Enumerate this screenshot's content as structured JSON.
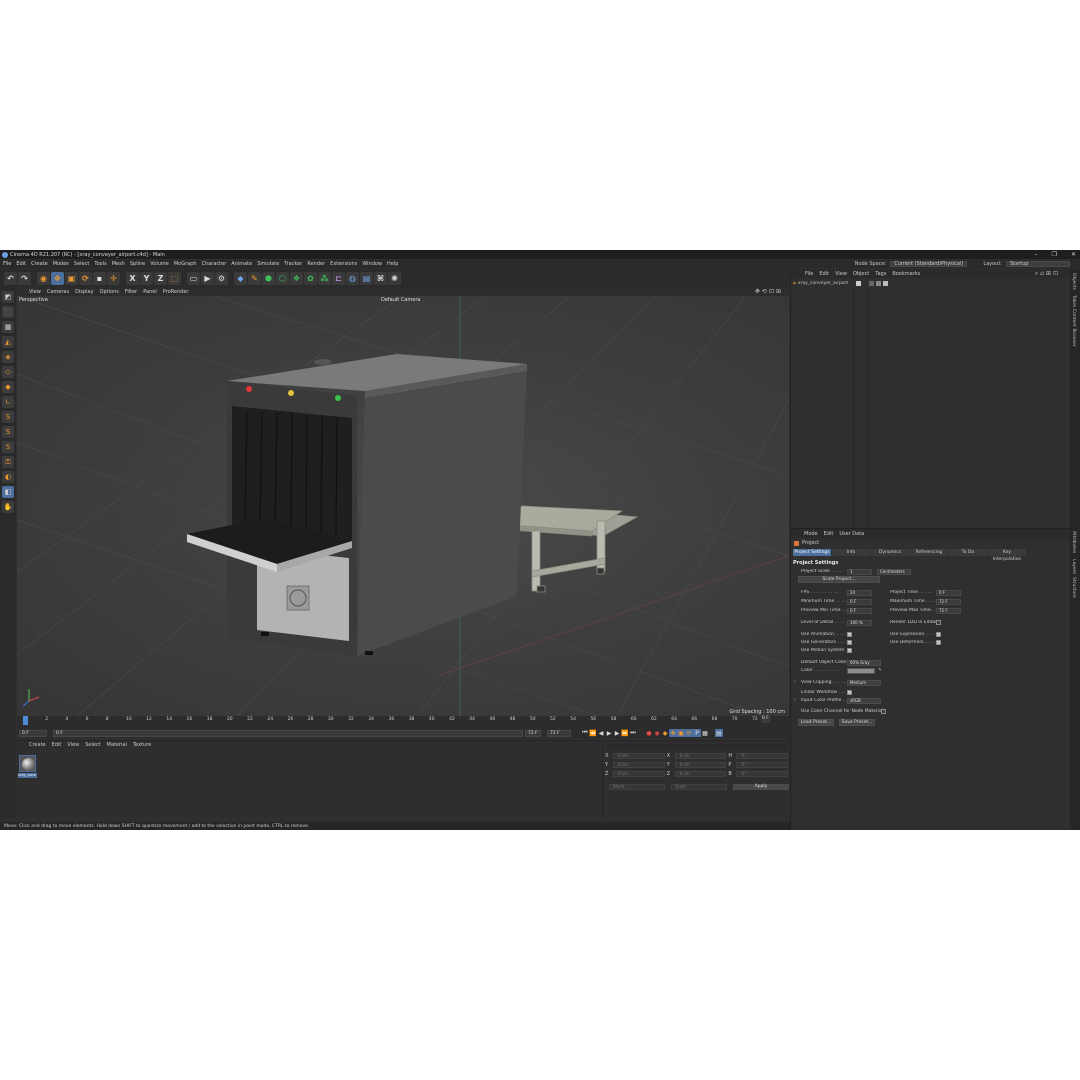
{
  "window": {
    "title": "Cinema 4D R21.207 (RC) - [xray_conveyer_airport.c4d] - Main",
    "controls": [
      "–",
      "❐",
      "✕"
    ]
  },
  "menubar": {
    "items": [
      "File",
      "Edit",
      "Create",
      "Modes",
      "Select",
      "Tools",
      "Mesh",
      "Spline",
      "Volume",
      "MoGraph",
      "Character",
      "Animate",
      "Simulate",
      "Tracker",
      "Render",
      "Extensions",
      "Window",
      "Help"
    ],
    "node_space_label": "Node Space:",
    "node_space_value": "Current (Standard/Physical)",
    "layout_label": "Layout:",
    "layout_value": "Startup"
  },
  "toolbar": {
    "axis_x": "X",
    "axis_y": "Y",
    "axis_z": "Z"
  },
  "viewport": {
    "menu": [
      "View",
      "Cameras",
      "Display",
      "Options",
      "Filter",
      "Panel",
      "ProRender"
    ],
    "view_name": "Perspective",
    "camera": "Default Camera",
    "grid_spacing": "Grid Spacing : 100 cm"
  },
  "timeline": {
    "ticks": [
      "0",
      "2",
      "4",
      "6",
      "8",
      "10",
      "12",
      "14",
      "16",
      "18",
      "20",
      "22",
      "24",
      "26",
      "28",
      "30",
      "32",
      "34",
      "36",
      "38",
      "40",
      "42",
      "44",
      "46",
      "48",
      "50",
      "52",
      "54",
      "56",
      "58",
      "60",
      "62",
      "64",
      "66",
      "68",
      "70",
      "72"
    ],
    "end_frame_display": "0 F",
    "current_frame": "0 F",
    "start_field": "0 F",
    "end_field": "72 F",
    "end_field2": "72 F"
  },
  "material_manager": {
    "menu": [
      "Create",
      "Edit",
      "View",
      "Select",
      "Material",
      "Texture"
    ],
    "material_name": "xray_conv"
  },
  "coordinates": {
    "rows": [
      {
        "a": "X",
        "av": "0 cm",
        "b": "X",
        "bv": "0 cm",
        "c": "H",
        "cv": "0 °"
      },
      {
        "a": "Y",
        "av": "0 cm",
        "b": "Y",
        "bv": "0 cm",
        "c": "P",
        "cv": "0 °"
      },
      {
        "a": "Z",
        "av": "0 cm",
        "b": "Z",
        "bv": "0 cm",
        "c": "B",
        "cv": "0 °"
      }
    ],
    "mode": "World",
    "size_mode": "Scale",
    "apply": "Apply"
  },
  "statusbar": {
    "text": "Move: Click and drag to move elements. Hold down SHIFT to quantize movement / add to the selection in point mode, CTRL to remove."
  },
  "object_manager": {
    "menu": [
      "File",
      "Edit",
      "View",
      "Object",
      "Tags",
      "Bookmarks"
    ],
    "object_name": "xray_conveyer_airport"
  },
  "side_tabs": [
    "Objects",
    "Takes",
    "Content Browser",
    "Attributes",
    "Layers",
    "Structure"
  ],
  "attributes": {
    "menu": [
      "Mode",
      "Edit",
      "User Data"
    ],
    "object": "Project",
    "tabs": [
      "Project Settings",
      "Info",
      "Dynamics",
      "Referencing",
      "To Do",
      "Key Interpolation"
    ],
    "section": "Project Settings",
    "project_scale_label": "Project Scale . . . . .",
    "project_scale_value": "1",
    "project_scale_unit": "Centimeters",
    "scale_project_btn": "Scale Project...",
    "fps_label": "FPS . . . . . . . . . .",
    "fps_value": "24",
    "project_time_label": "Project Time . . . . .",
    "project_time_value": "0 F",
    "min_time_label": "Minimum Time . . . .",
    "min_time_value": "0 F",
    "max_time_label": "Maximum Time . . . .",
    "max_time_value": "72 F",
    "prev_min_label": "Preview Min Time. . .",
    "prev_min_value": "0 F",
    "prev_max_label": "Preview Max Time. . .",
    "prev_max_value": "72 F",
    "lod_label": "Level of Detail . . . .",
    "lod_value": "100 %",
    "render_lod_label": "Render LOD in Editor",
    "use_anim_label": "Use Animation. . . . .",
    "use_expr_label": "Use Expression. . . . .",
    "use_gen_label": "Use Generators . . . .",
    "use_def_label": "Use Deformers. . . . .",
    "use_motion_label": "Use Motion System",
    "def_color_label": "Default Object Color",
    "def_color_value": "60% Gray",
    "color_label": "Color . . . . . . . . .",
    "view_clip_label": "View Clipping . . . . .",
    "view_clip_value": "Medium",
    "linear_label": "Linear Workflow . . .",
    "input_profile_label": "Input Color Profile . .",
    "input_profile_value": "sRGB",
    "color_channel_label": "Use Color Channel for Node Material",
    "load_preset": "Load Preset...",
    "save_preset": "Save Preset..."
  }
}
